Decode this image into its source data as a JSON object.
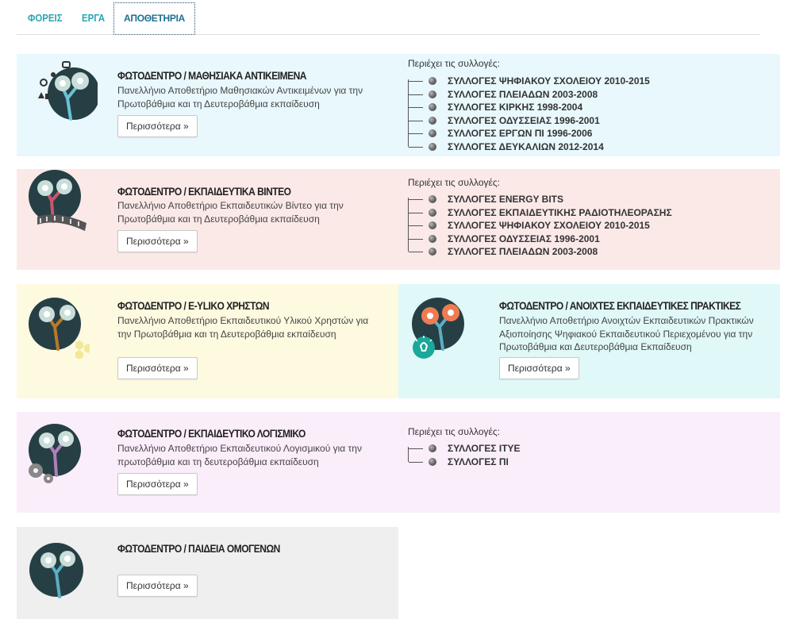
{
  "tabs": [
    {
      "label": "ΦΟΡΕΙΣ"
    },
    {
      "label": "ΕΡΓΑ"
    },
    {
      "label": "ΑΠΟΘΕΤΗΡΙΑ"
    }
  ],
  "contains_label": "Περιέχει τις συλλογές:",
  "more_label": "Περισσότερα »",
  "colors": {
    "accent": "#2aa6b3",
    "blue_bg": "#e8f8fc",
    "pink_bg": "#fbe9e8",
    "yellow_bg": "#fdfae0",
    "cyan_bg": "#e0f8f8",
    "lilac_bg": "#fbeefb",
    "gray_bg": "#efefef"
  },
  "repositories": [
    {
      "title": "ΦΩΤΟΔΕΝΤΡΟ / ΜΑΘΗΣΙΑΚΑ ΑΝΤΙΚΕΙΜΕΝΑ",
      "description": "Πανελλήνιο Αποθετήριο Μαθησιακών Αντικειμένων για την Πρωτοβάθμια και τη Δευτεροβάθμια εκπαίδευση",
      "icon": "science-tree-icon",
      "collections": [
        "ΣΥΛΛΟΓΕΣ ΨΗΦΙΑΚΟΥ ΣΧΟΛΕΙΟΥ 2010-2015",
        "ΣΥΛΛΟΓΕΣ ΠΛΕΙΑΔΩΝ 2003-2008",
        "ΣΥΛΛΟΓΕΣ ΚΙΡΚΗΣ 1998-2004",
        "ΣΥΛΛΟΓΕΣ ΟΔΥΣΣΕΙΑΣ 1996-2001",
        "ΣΥΛΛΟΓΕΣ ΕΡΓΩΝ ΠΙ 1996-2006",
        "ΣΥΛΛΟΓΕΣ ΔΕΥΚΑΛΙΩΝ 2012-2014"
      ]
    },
    {
      "title": "ΦΩΤΟΔΕΝΤΡΟ / ΕΚΠΑΙΔΕΥΤΙΚΑ ΒΙΝΤΕΟ",
      "description": "Πανελλήνιο Αποθετήριο Εκπαιδευτικών Βίντεο για την Πρωτοβάθμια και τη Δευτεροβάθμια εκπαίδευση",
      "icon": "film-tree-icon",
      "collections": [
        "ΣΥΛΛΟΓΕΣ ENERGY BITS",
        "ΣΥΛΛΟΓΕΣ ΕΚΠΑΙΔΕΥΤΙΚΗΣ ΡΑΔΙΟΤΗΛΕΟΡΑΣΗΣ",
        "ΣΥΛΛΟΓΕΣ ΨΗΦΙΑΚΟΥ ΣΧΟΛΕΙΟΥ 2010-2015",
        "ΣΥΛΛΟΓΕΣ ΟΔΥΣΣΕΙΑΣ 1996-2001",
        "ΣΥΛΛΟΓΕΣ ΠΛΕΙΑΔΩΝ 2003-2008"
      ]
    },
    {
      "title": "ΦΩΤΟΔΕΝΤΡΟ / E-YLIKO ΧΡΗΣΤΩΝ",
      "description": "Πανελλήνιο Αποθετήριο Εκπαιδευτικού Υλικού Χρηστών για την Πρωτοβάθμια και τη Δευτεροβάθμια εκπαίδευση",
      "icon": "hexagon-tree-icon"
    },
    {
      "title": "ΦΩΤΟΔΕΝΤΡΟ / ΑΝΟΙΧΤΕΣ ΕΚΠΑΙΔΕΥΤΙΚΕΣ ΠΡΑΚΤΙΚΕΣ",
      "description": "Πανελλήνιο Αποθετήριο Ανοιχτών Εκπαιδευτικών Πρακτικών Αξιοποίησης Ψηφιακού Εκπαιδευτικού Περιεχομένου για την Πρωτοβάθμια και Δευτεροβάθμια Εκπαίδευση",
      "icon": "lightbulb-tree-icon"
    },
    {
      "title": "ΦΩΤΟΔΕΝΤΡΟ / ΕΚΠΑΙΔΕΥΤΙΚΟ ΛΟΓΙΣΜΙΚΟ",
      "description": "Πανελλήνιο Αποθετήριο Εκπαιδευτικού Λογισμικού για την πρωτοβάθμια και τη δευτεροβάθμια εκπαίδευση",
      "icon": "gears-tree-icon",
      "collections": [
        "ΣΥΛΛΟΓΕΣ ΙΤΥΕ",
        "ΣΥΛΛΟΓΕΣ ΠΙ"
      ]
    },
    {
      "title": "ΦΩΤΟΔΕΝΤΡΟ / ΠΑΙΔΕΙΑ ΟΜΟΓΕΝΩΝ",
      "description": "",
      "icon": "tree-icon"
    }
  ]
}
